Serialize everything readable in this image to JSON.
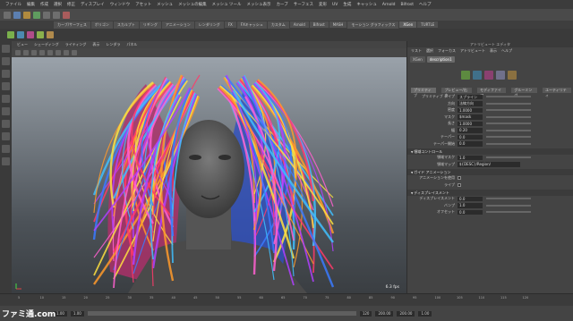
{
  "menubar": {
    "items": [
      "ファイル",
      "編集",
      "作成",
      "選択",
      "修正",
      "ディスプレイ",
      "ウィンドウ",
      "アセット",
      "メッシュ",
      "メッシュの編集",
      "メッシュ ツール",
      "メッシュ表示",
      "カーブ",
      "サーフェス",
      "変形",
      "UV",
      "生成",
      "キャッシュ",
      "Arnold",
      "Bifrost",
      "ヘルプ"
    ]
  },
  "shelf_tabs": [
    {
      "label": "カーブ/サーフェス",
      "active": false
    },
    {
      "label": "ポリゴン",
      "active": false
    },
    {
      "label": "スカルプト",
      "active": false
    },
    {
      "label": "リギング",
      "active": false
    },
    {
      "label": "アニメーション",
      "active": false
    },
    {
      "label": "レンダリング",
      "active": false
    },
    {
      "label": "FX",
      "active": false
    },
    {
      "label": "FXキャッシュ",
      "active": false
    },
    {
      "label": "カスタム",
      "active": false
    },
    {
      "label": "Arnold",
      "active": false
    },
    {
      "label": "Bifrost",
      "active": false
    },
    {
      "label": "MASH",
      "active": false
    },
    {
      "label": "モーション グラフィックス",
      "active": false
    },
    {
      "label": "XGen",
      "active": true
    },
    {
      "label": "TURTLE",
      "active": false
    }
  ],
  "viewport": {
    "menus": [
      "ビュー",
      "シェーディング",
      "ライティング",
      "表示",
      "レンダラ",
      "パネル"
    ],
    "fps": "6.3 fps"
  },
  "panel": {
    "title": "アトリビュート エディタ",
    "menus": [
      "リスト",
      "選択",
      "フォーカス",
      "アトリビュート",
      "表示",
      "ヘルプ"
    ],
    "node_tabs": [
      {
        "label": "XGen",
        "active": false
      },
      {
        "label": "description1",
        "active": true
      }
    ],
    "tabs": [
      "プリミティブ",
      "プレビュー/出力",
      "モディファイア",
      "グルーミング",
      "ユーティリティ"
    ],
    "rows1": [
      {
        "label": "プリミティブ タイプ",
        "value": "スプライン"
      },
      {
        "label": "方向",
        "value": "法線方向"
      },
      {
        "label": "密度",
        "value": "1.0000"
      },
      {
        "label": "マスク",
        "value": "$mask"
      },
      {
        "label": "長さ",
        "value": "1.0000"
      },
      {
        "label": "幅",
        "value": "0.20"
      },
      {
        "label": "テーパー",
        "value": "0.0"
      },
      {
        "label": "テーパー開始",
        "value": "0.0"
      }
    ],
    "section2": "領域コントロール",
    "rows2": [
      {
        "label": "領域マスク",
        "value": "1.0"
      },
      {
        "label": "領域マップ",
        "value": "${DESC}/Region/"
      }
    ],
    "section3": "ガイド アニメーション",
    "rows3": [
      {
        "label": "アニメーションを使用",
        "value": ""
      },
      {
        "label": "ライブ",
        "value": ""
      }
    ],
    "section4": "ディスプレイスメント",
    "rows4": [
      {
        "label": "ディスプレイスメント",
        "value": "0.0"
      },
      {
        "label": "バンプ",
        "value": "1.0"
      },
      {
        "label": "オフセット",
        "value": "0.0"
      }
    ]
  },
  "timeline": {
    "ticks": [
      "5",
      "10",
      "15",
      "20",
      "25",
      "30",
      "35",
      "40",
      "45",
      "50",
      "55",
      "60",
      "65",
      "70",
      "75",
      "80",
      "85",
      "90",
      "95",
      "100",
      "105",
      "110",
      "115",
      "120"
    ],
    "current_frame": "1.00"
  },
  "range": {
    "start": "1.00",
    "start2": "1.00",
    "end": "120",
    "end2": "200.00",
    "end3": "200.00"
  },
  "logo_text": "ファミ通.com",
  "colors": {
    "hair": [
      "#ff3a6a",
      "#ff9a2a",
      "#ffe040",
      "#3a7aff",
      "#b040ff",
      "#40c0ff",
      "#ff60d0"
    ]
  }
}
